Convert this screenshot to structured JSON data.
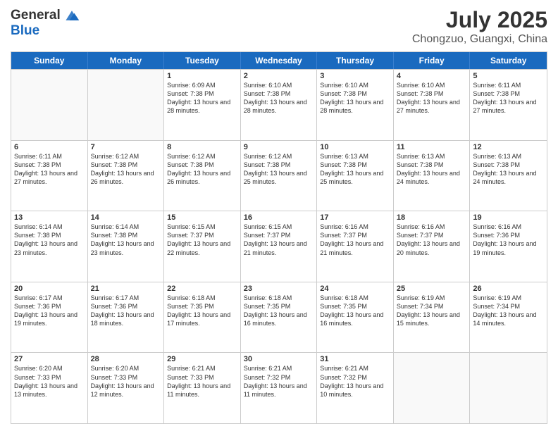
{
  "header": {
    "logo_line1": "General",
    "logo_line2": "Blue",
    "month_year": "July 2025",
    "location": "Chongzuo, Guangxi, China"
  },
  "days_of_week": [
    "Sunday",
    "Monday",
    "Tuesday",
    "Wednesday",
    "Thursday",
    "Friday",
    "Saturday"
  ],
  "rows": [
    [
      {
        "day": "",
        "text": ""
      },
      {
        "day": "",
        "text": ""
      },
      {
        "day": "1",
        "text": "Sunrise: 6:09 AM\nSunset: 7:38 PM\nDaylight: 13 hours and 28 minutes."
      },
      {
        "day": "2",
        "text": "Sunrise: 6:10 AM\nSunset: 7:38 PM\nDaylight: 13 hours and 28 minutes."
      },
      {
        "day": "3",
        "text": "Sunrise: 6:10 AM\nSunset: 7:38 PM\nDaylight: 13 hours and 28 minutes."
      },
      {
        "day": "4",
        "text": "Sunrise: 6:10 AM\nSunset: 7:38 PM\nDaylight: 13 hours and 27 minutes."
      },
      {
        "day": "5",
        "text": "Sunrise: 6:11 AM\nSunset: 7:38 PM\nDaylight: 13 hours and 27 minutes."
      }
    ],
    [
      {
        "day": "6",
        "text": "Sunrise: 6:11 AM\nSunset: 7:38 PM\nDaylight: 13 hours and 27 minutes."
      },
      {
        "day": "7",
        "text": "Sunrise: 6:12 AM\nSunset: 7:38 PM\nDaylight: 13 hours and 26 minutes."
      },
      {
        "day": "8",
        "text": "Sunrise: 6:12 AM\nSunset: 7:38 PM\nDaylight: 13 hours and 26 minutes."
      },
      {
        "day": "9",
        "text": "Sunrise: 6:12 AM\nSunset: 7:38 PM\nDaylight: 13 hours and 25 minutes."
      },
      {
        "day": "10",
        "text": "Sunrise: 6:13 AM\nSunset: 7:38 PM\nDaylight: 13 hours and 25 minutes."
      },
      {
        "day": "11",
        "text": "Sunrise: 6:13 AM\nSunset: 7:38 PM\nDaylight: 13 hours and 24 minutes."
      },
      {
        "day": "12",
        "text": "Sunrise: 6:13 AM\nSunset: 7:38 PM\nDaylight: 13 hours and 24 minutes."
      }
    ],
    [
      {
        "day": "13",
        "text": "Sunrise: 6:14 AM\nSunset: 7:38 PM\nDaylight: 13 hours and 23 minutes."
      },
      {
        "day": "14",
        "text": "Sunrise: 6:14 AM\nSunset: 7:38 PM\nDaylight: 13 hours and 23 minutes."
      },
      {
        "day": "15",
        "text": "Sunrise: 6:15 AM\nSunset: 7:37 PM\nDaylight: 13 hours and 22 minutes."
      },
      {
        "day": "16",
        "text": "Sunrise: 6:15 AM\nSunset: 7:37 PM\nDaylight: 13 hours and 21 minutes."
      },
      {
        "day": "17",
        "text": "Sunrise: 6:16 AM\nSunset: 7:37 PM\nDaylight: 13 hours and 21 minutes."
      },
      {
        "day": "18",
        "text": "Sunrise: 6:16 AM\nSunset: 7:37 PM\nDaylight: 13 hours and 20 minutes."
      },
      {
        "day": "19",
        "text": "Sunrise: 6:16 AM\nSunset: 7:36 PM\nDaylight: 13 hours and 19 minutes."
      }
    ],
    [
      {
        "day": "20",
        "text": "Sunrise: 6:17 AM\nSunset: 7:36 PM\nDaylight: 13 hours and 19 minutes."
      },
      {
        "day": "21",
        "text": "Sunrise: 6:17 AM\nSunset: 7:36 PM\nDaylight: 13 hours and 18 minutes."
      },
      {
        "day": "22",
        "text": "Sunrise: 6:18 AM\nSunset: 7:35 PM\nDaylight: 13 hours and 17 minutes."
      },
      {
        "day": "23",
        "text": "Sunrise: 6:18 AM\nSunset: 7:35 PM\nDaylight: 13 hours and 16 minutes."
      },
      {
        "day": "24",
        "text": "Sunrise: 6:18 AM\nSunset: 7:35 PM\nDaylight: 13 hours and 16 minutes."
      },
      {
        "day": "25",
        "text": "Sunrise: 6:19 AM\nSunset: 7:34 PM\nDaylight: 13 hours and 15 minutes."
      },
      {
        "day": "26",
        "text": "Sunrise: 6:19 AM\nSunset: 7:34 PM\nDaylight: 13 hours and 14 minutes."
      }
    ],
    [
      {
        "day": "27",
        "text": "Sunrise: 6:20 AM\nSunset: 7:33 PM\nDaylight: 13 hours and 13 minutes."
      },
      {
        "day": "28",
        "text": "Sunrise: 6:20 AM\nSunset: 7:33 PM\nDaylight: 13 hours and 12 minutes."
      },
      {
        "day": "29",
        "text": "Sunrise: 6:21 AM\nSunset: 7:33 PM\nDaylight: 13 hours and 11 minutes."
      },
      {
        "day": "30",
        "text": "Sunrise: 6:21 AM\nSunset: 7:32 PM\nDaylight: 13 hours and 11 minutes."
      },
      {
        "day": "31",
        "text": "Sunrise: 6:21 AM\nSunset: 7:32 PM\nDaylight: 13 hours and 10 minutes."
      },
      {
        "day": "",
        "text": ""
      },
      {
        "day": "",
        "text": ""
      }
    ]
  ]
}
